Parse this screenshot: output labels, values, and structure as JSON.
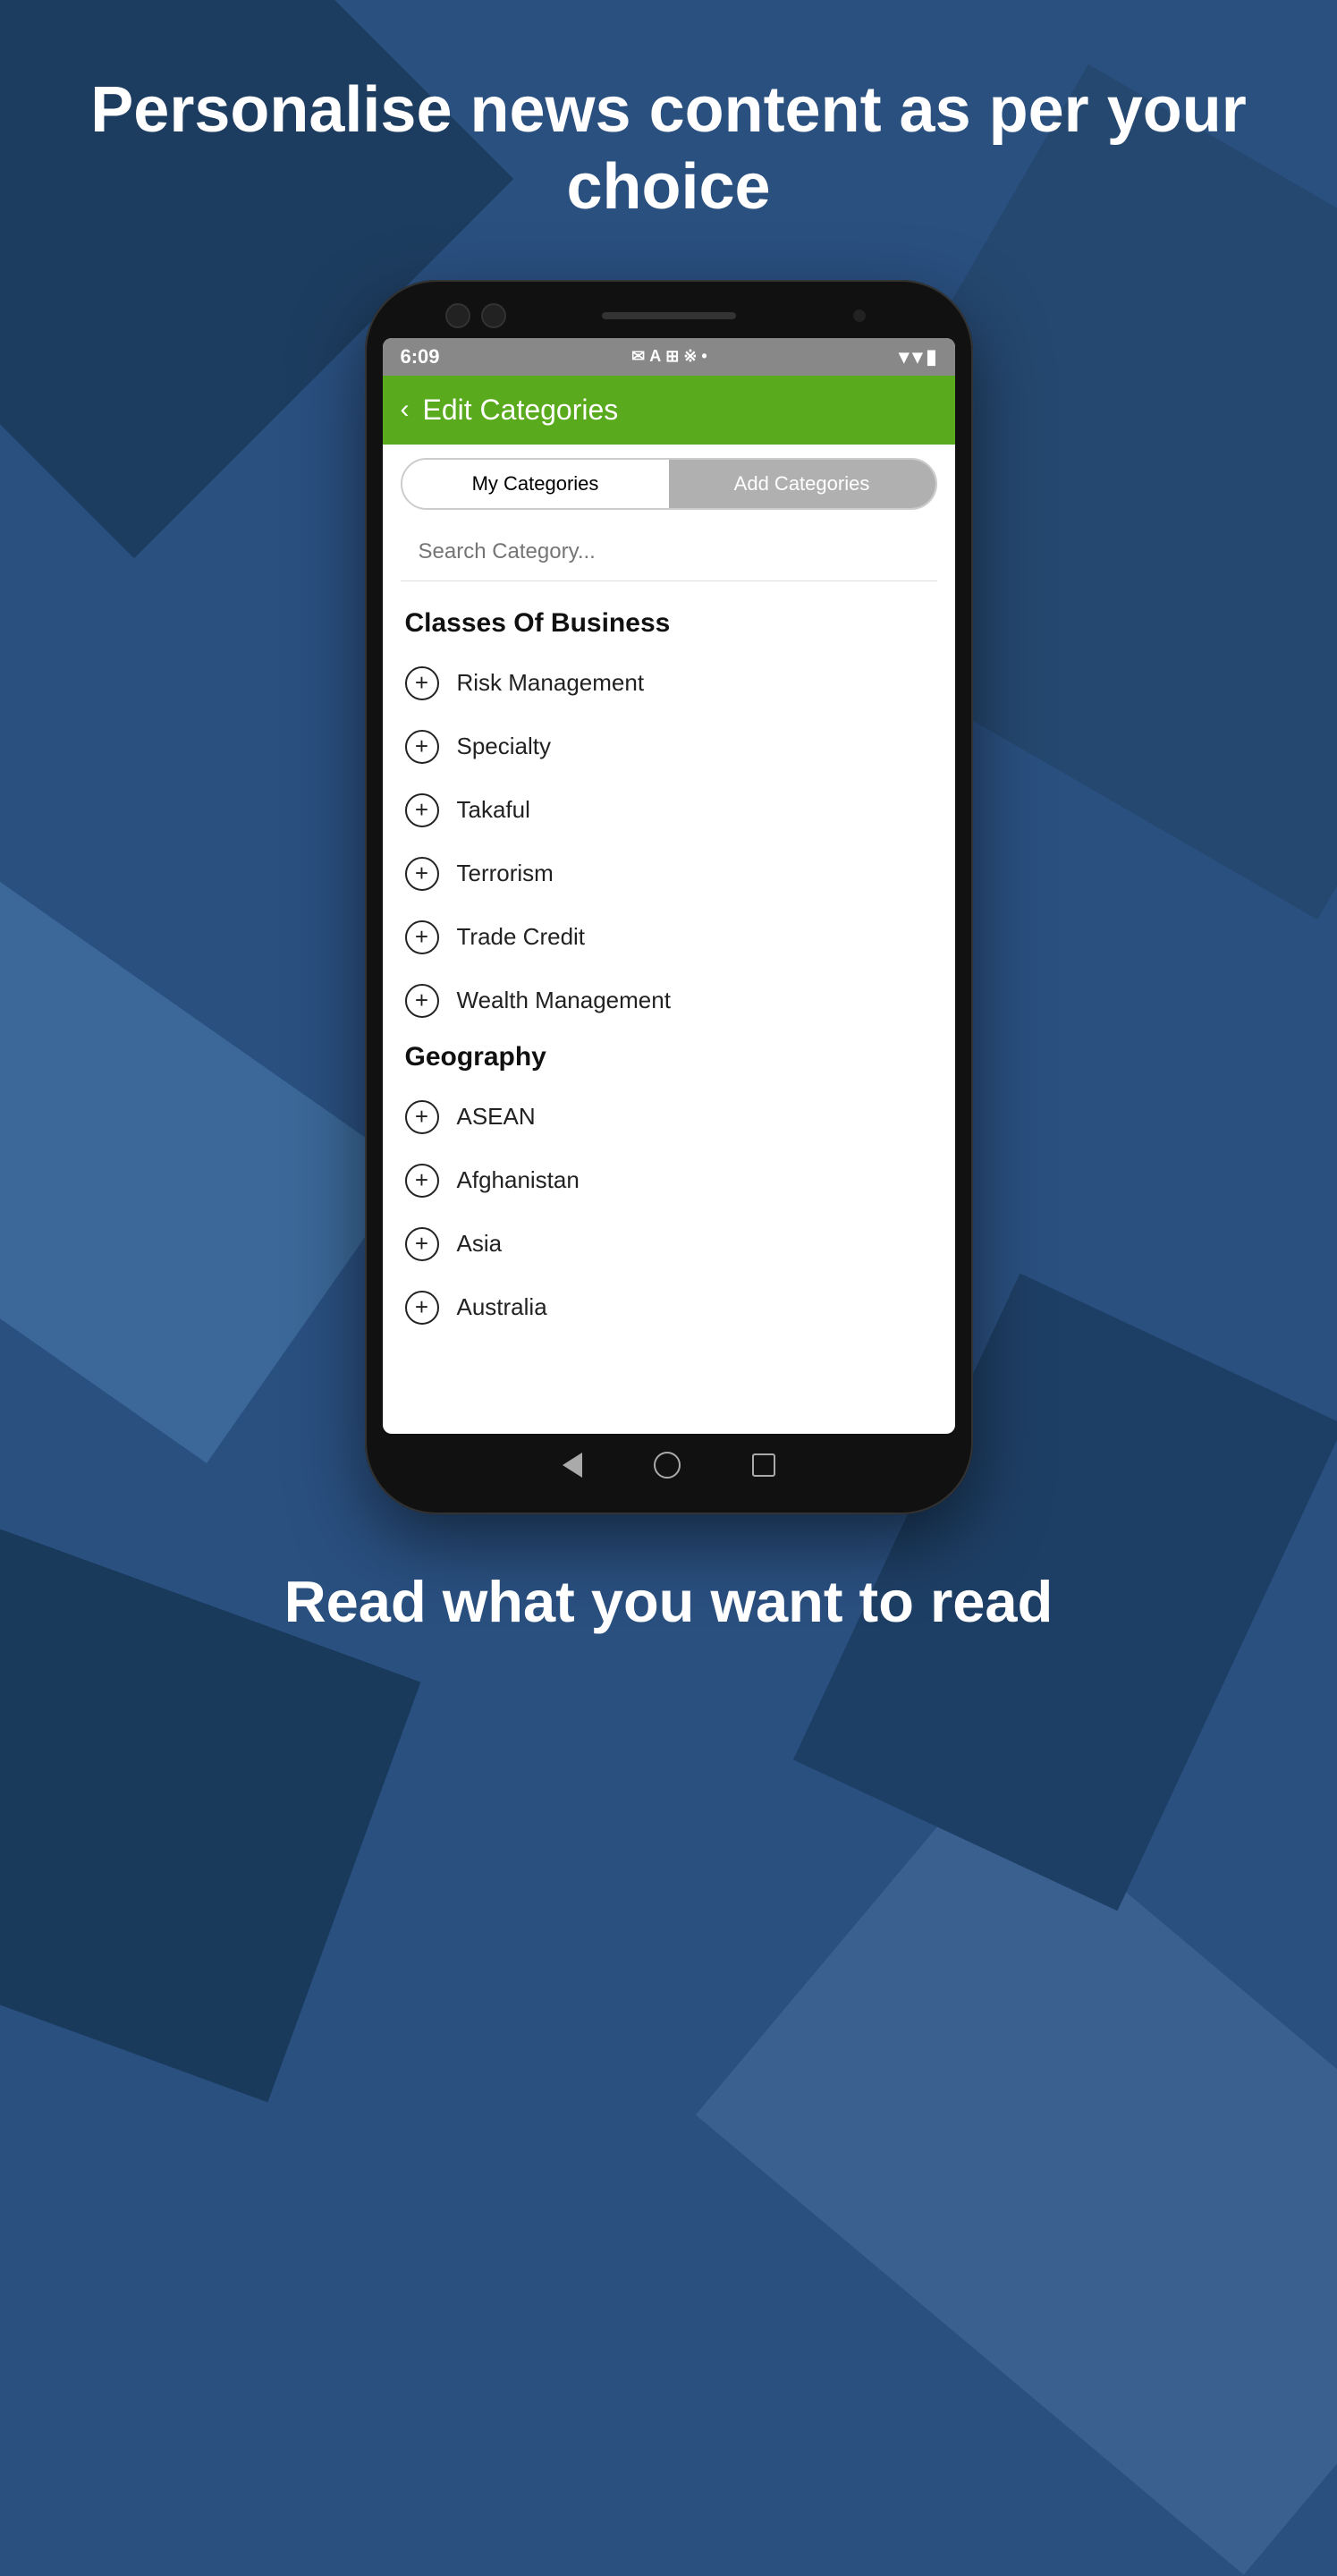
{
  "page": {
    "header_title": "Personalise news content as per your choice",
    "footer_title": "Read what you want to read",
    "header_colors": {
      "background": "#2a5080",
      "text": "#ffffff"
    }
  },
  "app": {
    "app_bar": {
      "back_label": "‹",
      "title": "Edit Categories"
    },
    "tabs": [
      {
        "label": "My Categories",
        "active": true
      },
      {
        "label": "Add Categories",
        "active": false
      }
    ],
    "search": {
      "placeholder": "Search Category..."
    },
    "sections": [
      {
        "title": "Classes Of Business",
        "items": [
          {
            "label": "Risk Management"
          },
          {
            "label": "Specialty"
          },
          {
            "label": "Takaful"
          },
          {
            "label": "Terrorism"
          },
          {
            "label": "Trade Credit"
          },
          {
            "label": "Wealth Management"
          }
        ]
      },
      {
        "title": "Geography",
        "items": [
          {
            "label": "ASEAN"
          },
          {
            "label": "Afghanistan"
          },
          {
            "label": "Asia"
          },
          {
            "label": "Australia"
          }
        ]
      }
    ]
  },
  "status_bar": {
    "time": "6:09",
    "right_icons": "▾▾▮"
  }
}
